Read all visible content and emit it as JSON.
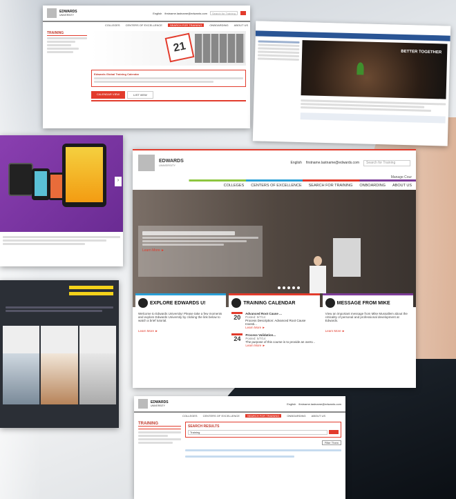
{
  "brand": {
    "name": "EDWARDS",
    "sub": "UNIVERSITY",
    "accent": "#e23b2c"
  },
  "top_panel": {
    "lang": "English",
    "email": "firstname.lastname@edwards.com",
    "search_placeholder": "Search for Training",
    "nav": [
      "COLLEGES",
      "CENTERS OF EXCELLENCE",
      "SEARCH FOR TRAINING",
      "ONBOARDING",
      "ABOUT US"
    ],
    "section": "TRAINING",
    "calendar_day": "21",
    "notice_title": "Edwards Global Training Calendar",
    "tabs": [
      "CALENDAR VIEW",
      "LIST VIEW"
    ]
  },
  "main": {
    "lang": "English",
    "email": "firstname.lastname@edwards.com",
    "search_placeholder": "Search for Training",
    "manage": "Manage Cour",
    "nav": [
      "COLLEGES",
      "CENTERS OF EXCELLENCE",
      "SEARCH FOR TRAINING",
      "ONBOARDING",
      "ABOUT US"
    ],
    "hero_more": "Learn More ►",
    "cards": [
      {
        "title": "EXPLORE EDWARDS U!",
        "body": "Welcome to Edwards University! Please take a few moments and explore Edwards University by clicking the link below to watch a brief tutorial.",
        "link": "Learn More ►"
      },
      {
        "title": "TRAINING CALENDAR",
        "events": [
          {
            "day": "20",
            "title": "Advanced Root Cause ...",
            "date": "Posted: 5/7/14",
            "desc": "Process Description: Advanced Root Cause Investi...",
            "link": "Learn More ►"
          },
          {
            "day": "24",
            "title": "Process Validation...",
            "date": "Posted: 5/7/14",
            "desc": "The purpose of this course is to provide an overv...",
            "link": "Learn More ►"
          }
        ]
      },
      {
        "title": "MESSAGE FROM MIKE",
        "body": "View an important message from Mike Mussallem about the criticality of personal and professional development at Edwards.",
        "link": "Learn More ►"
      }
    ]
  },
  "bottom": {
    "lang": "English",
    "email": "firstname.lastname@edwards.com",
    "nav": [
      "COLLEGES",
      "CENTERS OF EXCELLENCE",
      "SEARCH FOR TRAINING",
      "ONBOARDING",
      "ABOUT US"
    ],
    "section": "TRAINING",
    "results_title": "SEARCH RESULTS",
    "query": "Training",
    "refine": "Filter Them"
  },
  "right_panel": {
    "headline": "BETTER TOGETHER"
  }
}
